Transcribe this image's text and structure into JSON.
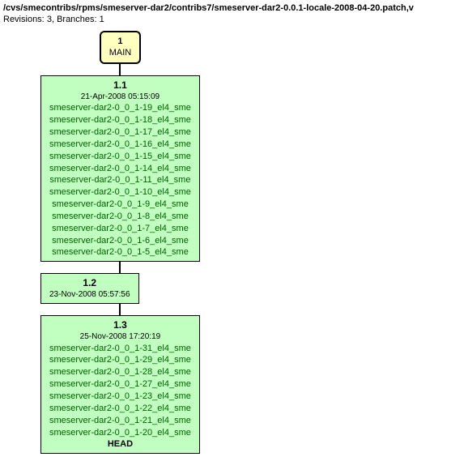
{
  "header": {
    "path": "/cvs/smecontribs/rpms/smeserver-dar2/contribs7/smeserver-dar2-0.0.1-locale-2008-04-20.patch,v",
    "revisions_label": "Revisions:",
    "revisions": "3",
    "branches_label": "Branches:",
    "branches": "1"
  },
  "branch": {
    "num": "1",
    "name": "MAIN"
  },
  "nodes": [
    {
      "rev": "1.1",
      "date": "21-Apr-2008 05:15:09",
      "tags": [
        "smeserver-dar2-0_0_1-19_el4_sme",
        "smeserver-dar2-0_0_1-18_el4_sme",
        "smeserver-dar2-0_0_1-17_el4_sme",
        "smeserver-dar2-0_0_1-16_el4_sme",
        "smeserver-dar2-0_0_1-15_el4_sme",
        "smeserver-dar2-0_0_1-14_el4_sme",
        "smeserver-dar2-0_0_1-11_el4_sme",
        "smeserver-dar2-0_0_1-10_el4_sme",
        "smeserver-dar2-0_0_1-9_el4_sme",
        "smeserver-dar2-0_0_1-8_el4_sme",
        "smeserver-dar2-0_0_1-7_el4_sme",
        "smeserver-dar2-0_0_1-6_el4_sme",
        "smeserver-dar2-0_0_1-5_el4_sme"
      ],
      "head": ""
    },
    {
      "rev": "1.2",
      "date": "23-Nov-2008 05:57:56",
      "tags": [],
      "head": ""
    },
    {
      "rev": "1.3",
      "date": "25-Nov-2008 17:20:19",
      "tags": [
        "smeserver-dar2-0_0_1-31_el4_sme",
        "smeserver-dar2-0_0_1-29_el4_sme",
        "smeserver-dar2-0_0_1-28_el4_sme",
        "smeserver-dar2-0_0_1-27_el4_sme",
        "smeserver-dar2-0_0_1-23_el4_sme",
        "smeserver-dar2-0_0_1-22_el4_sme",
        "smeserver-dar2-0_0_1-21_el4_sme",
        "smeserver-dar2-0_0_1-20_el4_sme"
      ],
      "head": "HEAD"
    }
  ]
}
